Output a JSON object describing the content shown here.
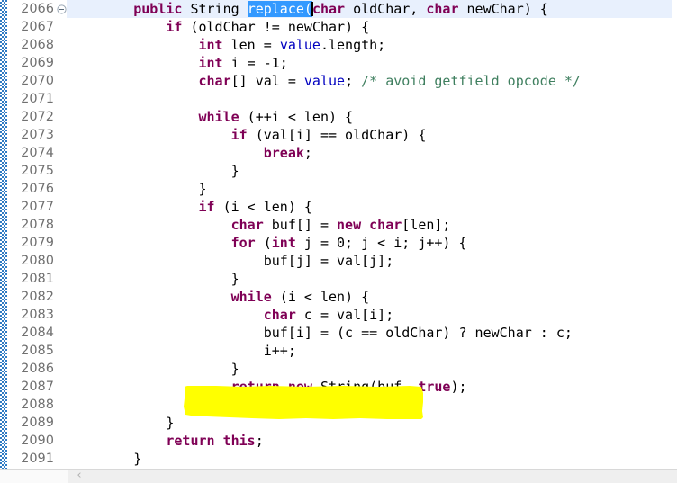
{
  "editor": {
    "app": "java-code-editor",
    "language": "Java",
    "first_line_number": 2066,
    "line_height_px": 20,
    "colors": {
      "background": "#ffffff",
      "keyword": "#7f0055",
      "field": "#0000c0",
      "comment": "#3f7f5f",
      "plain_text": "#000000",
      "line_number": "#707070",
      "current_line_highlight": "#e8f0fd",
      "selection_background": "#3399ff",
      "selection_foreground": "#ffffff",
      "annotation_ruler": "#2e7bc4",
      "highlighter_marker": "#ffff00",
      "scrollbar_track": "#efefef",
      "scrollbar_arrow": "#b0b0b0"
    },
    "gutter": {
      "fold_marker_icon": "collapse-minus-icon",
      "fold_marker_line": 2066,
      "line_numbers": [
        "2066",
        "2067",
        "2068",
        "2069",
        "2070",
        "2071",
        "2072",
        "2073",
        "2074",
        "2075",
        "2076",
        "2077",
        "2078",
        "2079",
        "2080",
        "2081",
        "2082",
        "2083",
        "2084",
        "2085",
        "2086",
        "2087",
        "2088",
        "2089",
        "2090",
        "2091"
      ]
    },
    "selection": {
      "line": 2066,
      "text": "replace(",
      "caret_after": "("
    },
    "annotations": [
      {
        "type": "freehand-highlighter",
        "color": "#ffff00",
        "covers_line": 2087,
        "covers_text": "return new String(buf, true);"
      }
    ],
    "scrollbar": {
      "orientation": "horizontal",
      "left_arrow_glyph": "‹"
    },
    "lines": [
      {
        "n": "2066",
        "fold": true,
        "tokens": [
          {
            "t": "        ",
            "c": "plain"
          },
          {
            "t": "public",
            "c": "kw"
          },
          {
            "t": " ",
            "c": "plain"
          },
          {
            "t": "String",
            "c": "plain"
          },
          {
            "t": " ",
            "c": "plain"
          },
          {
            "t": "replace(",
            "c": "sel"
          },
          {
            "t": "char",
            "c": "kw"
          },
          {
            "t": " oldChar, ",
            "c": "plain"
          },
          {
            "t": "char",
            "c": "kw"
          },
          {
            "t": " newChar) {",
            "c": "plain"
          }
        ]
      },
      {
        "n": "2067",
        "fold": false,
        "tokens": [
          {
            "t": "            ",
            "c": "plain"
          },
          {
            "t": "if",
            "c": "kw"
          },
          {
            "t": " (oldChar != newChar) {",
            "c": "plain"
          }
        ]
      },
      {
        "n": "2068",
        "fold": false,
        "tokens": [
          {
            "t": "                ",
            "c": "plain"
          },
          {
            "t": "int",
            "c": "kw"
          },
          {
            "t": " len = ",
            "c": "plain"
          },
          {
            "t": "value",
            "c": "fld"
          },
          {
            "t": ".length;",
            "c": "plain"
          }
        ]
      },
      {
        "n": "2069",
        "fold": false,
        "tokens": [
          {
            "t": "                ",
            "c": "plain"
          },
          {
            "t": "int",
            "c": "kw"
          },
          {
            "t": " i = -1;",
            "c": "plain"
          }
        ]
      },
      {
        "n": "2070",
        "fold": false,
        "tokens": [
          {
            "t": "                ",
            "c": "plain"
          },
          {
            "t": "char",
            "c": "kw"
          },
          {
            "t": "[] val = ",
            "c": "plain"
          },
          {
            "t": "value",
            "c": "fld"
          },
          {
            "t": "; ",
            "c": "plain"
          },
          {
            "t": "/* avoid getfield opcode */",
            "c": "cmt"
          }
        ]
      },
      {
        "n": "2071",
        "fold": false,
        "tokens": []
      },
      {
        "n": "2072",
        "fold": false,
        "tokens": [
          {
            "t": "                ",
            "c": "plain"
          },
          {
            "t": "while",
            "c": "kw"
          },
          {
            "t": " (++i < len) {",
            "c": "plain"
          }
        ]
      },
      {
        "n": "2073",
        "fold": false,
        "tokens": [
          {
            "t": "                    ",
            "c": "plain"
          },
          {
            "t": "if",
            "c": "kw"
          },
          {
            "t": " (val[i] == oldChar) {",
            "c": "plain"
          }
        ]
      },
      {
        "n": "2074",
        "fold": false,
        "tokens": [
          {
            "t": "                        ",
            "c": "plain"
          },
          {
            "t": "break",
            "c": "kw"
          },
          {
            "t": ";",
            "c": "plain"
          }
        ]
      },
      {
        "n": "2075",
        "fold": false,
        "tokens": [
          {
            "t": "                    }",
            "c": "plain"
          }
        ]
      },
      {
        "n": "2076",
        "fold": false,
        "tokens": [
          {
            "t": "                }",
            "c": "plain"
          }
        ]
      },
      {
        "n": "2077",
        "fold": false,
        "tokens": [
          {
            "t": "                ",
            "c": "plain"
          },
          {
            "t": "if",
            "c": "kw"
          },
          {
            "t": " (i < len) {",
            "c": "plain"
          }
        ]
      },
      {
        "n": "2078",
        "fold": false,
        "tokens": [
          {
            "t": "                    ",
            "c": "plain"
          },
          {
            "t": "char",
            "c": "kw"
          },
          {
            "t": " buf[] = ",
            "c": "plain"
          },
          {
            "t": "new",
            "c": "kw"
          },
          {
            "t": " ",
            "c": "plain"
          },
          {
            "t": "char",
            "c": "kw"
          },
          {
            "t": "[len];",
            "c": "plain"
          }
        ]
      },
      {
        "n": "2079",
        "fold": false,
        "tokens": [
          {
            "t": "                    ",
            "c": "plain"
          },
          {
            "t": "for",
            "c": "kw"
          },
          {
            "t": " (",
            "c": "plain"
          },
          {
            "t": "int",
            "c": "kw"
          },
          {
            "t": " j = 0; j < i; j++) {",
            "c": "plain"
          }
        ]
      },
      {
        "n": "2080",
        "fold": false,
        "tokens": [
          {
            "t": "                        buf[j] = val[j];",
            "c": "plain"
          }
        ]
      },
      {
        "n": "2081",
        "fold": false,
        "tokens": [
          {
            "t": "                    }",
            "c": "plain"
          }
        ]
      },
      {
        "n": "2082",
        "fold": false,
        "tokens": [
          {
            "t": "                    ",
            "c": "plain"
          },
          {
            "t": "while",
            "c": "kw"
          },
          {
            "t": " (i < len) {",
            "c": "plain"
          }
        ]
      },
      {
        "n": "2083",
        "fold": false,
        "tokens": [
          {
            "t": "                        ",
            "c": "plain"
          },
          {
            "t": "char",
            "c": "kw"
          },
          {
            "t": " c = val[i];",
            "c": "plain"
          }
        ]
      },
      {
        "n": "2084",
        "fold": false,
        "tokens": [
          {
            "t": "                        buf[i] = (c == oldChar) ? newChar : c;",
            "c": "plain"
          }
        ]
      },
      {
        "n": "2085",
        "fold": false,
        "tokens": [
          {
            "t": "                        i++;",
            "c": "plain"
          }
        ]
      },
      {
        "n": "2086",
        "fold": false,
        "tokens": [
          {
            "t": "                    }",
            "c": "plain"
          }
        ]
      },
      {
        "n": "2087",
        "fold": false,
        "tokens": [
          {
            "t": "                    ",
            "c": "plain"
          },
          {
            "t": "return",
            "c": "kw"
          },
          {
            "t": " ",
            "c": "plain"
          },
          {
            "t": "new",
            "c": "kw"
          },
          {
            "t": " String(buf, ",
            "c": "plain"
          },
          {
            "t": "true",
            "c": "kw"
          },
          {
            "t": ");",
            "c": "plain"
          }
        ]
      },
      {
        "n": "2088",
        "fold": false,
        "tokens": [
          {
            "t": "                }",
            "c": "plain"
          }
        ]
      },
      {
        "n": "2089",
        "fold": false,
        "tokens": [
          {
            "t": "            }",
            "c": "plain"
          }
        ]
      },
      {
        "n": "2090",
        "fold": false,
        "tokens": [
          {
            "t": "            ",
            "c": "plain"
          },
          {
            "t": "return",
            "c": "kw"
          },
          {
            "t": " ",
            "c": "plain"
          },
          {
            "t": "this",
            "c": "kw"
          },
          {
            "t": ";",
            "c": "plain"
          }
        ]
      },
      {
        "n": "2091",
        "fold": false,
        "tokens": [
          {
            "t": "        }",
            "c": "plain"
          }
        ]
      }
    ]
  }
}
